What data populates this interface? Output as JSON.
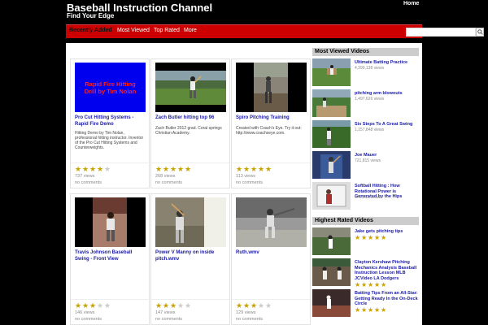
{
  "header": {
    "title": "Baseball Instruction Channel",
    "tagline": "Find Your Edge",
    "home_label": "Home"
  },
  "nav": {
    "items": [
      "Recently Added",
      "Most Viewed",
      "Top Rated",
      "More"
    ],
    "search_placeholder": ""
  },
  "videos": [
    {
      "title": "Pro Cut Hitting Systems - Rapid Fire Demo",
      "thumb_text": "Rapid Fire Hitting Drill by Tim Nolan",
      "desc": "Hitting Demo by Tim Nolan, professional hitting instructor. Inventor of the Pro Cut Hitting Systems and Counterweights.",
      "rating": 4,
      "views": "737 views",
      "comments": "no comments"
    },
    {
      "title": "Zach Butler hitting top 96",
      "thumb_text": "",
      "desc": "Zach Butler 2012 grad. Coral springs Christian Academy.",
      "rating": 5,
      "views": "268 views",
      "comments": "no comments"
    },
    {
      "title": "Spiro Pitching Training",
      "thumb_text": "",
      "desc": "Created with Coach's Eye. Try it out: http://www.coachseye.com.",
      "rating": 5,
      "views": "113 views",
      "comments": "no comments"
    },
    {
      "title": "Travis Johnson Baseball Swing - Front View",
      "thumb_text": "",
      "desc": "",
      "rating": 3,
      "views": "146 views",
      "comments": "no comments"
    },
    {
      "title": "Power V Manny on inside pitch.wmv",
      "thumb_text": "",
      "desc": "",
      "rating": 3,
      "views": "147 views",
      "comments": "no comments"
    },
    {
      "title": "Ruth.wmv",
      "thumb_text": "",
      "desc": "",
      "rating": 3,
      "views": "129 views",
      "comments": "no comments"
    }
  ],
  "most_viewed": {
    "heading": "Most Viewed Videos",
    "items": [
      {
        "title": "Ultimate Batting Practice",
        "views": "4,399,138 views"
      },
      {
        "title": "pitching arm blowouts",
        "views": "1,497,626 views"
      },
      {
        "title": "Six Steps To A Great Swing",
        "views": "1,157,848 views"
      },
      {
        "title": "Joe Mauer",
        "views": "721,815 views"
      },
      {
        "title": "Softball Hitting : How Rotational Power is Generated by the Hips",
        "views": "679,663 views"
      }
    ]
  },
  "highest_rated": {
    "heading": "Highest Rated Videos",
    "items": [
      {
        "title": "Jake gets pitching tips",
        "rating": 5
      },
      {
        "title": "Clayton Kershaw Pitching Mechanics Analysis Baseball Instruction Lesson MLB JCVideo LA Dodgers",
        "rating": 5
      },
      {
        "title": "Batting Tips From an All-Star: Getting Ready In the On-Deck Circle",
        "rating": 5
      }
    ]
  },
  "colors": {
    "nav_red": "#cc0000",
    "link_blue": "#1a1aa8",
    "star_gold": "#c8a200"
  }
}
